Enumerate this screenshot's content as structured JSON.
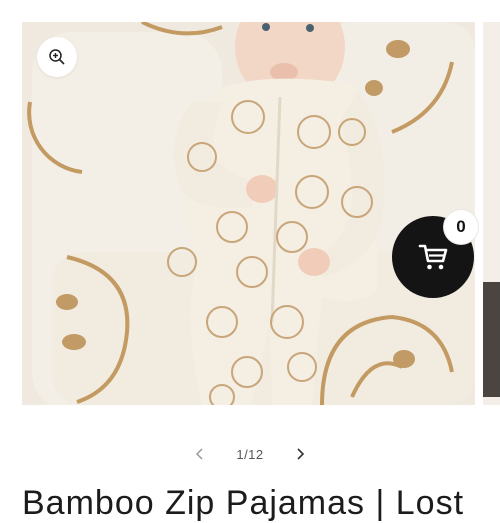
{
  "gallery": {
    "image_alt": "Baby in smiley face zip pajamas lying on smiley blanket",
    "zoom_icon": "zoom-in-icon"
  },
  "cart": {
    "icon": "cart-icon",
    "count": "0"
  },
  "pager": {
    "prev_icon": "chevron-left-icon",
    "next_icon": "chevron-right-icon",
    "current": 1,
    "total": 12,
    "label": "1/12"
  },
  "product": {
    "title": "Bamboo Zip Pajamas | Lost"
  },
  "colors": {
    "cart_bg": "#141414",
    "smiley": "#b9915a",
    "fabric": "#f2ecdf"
  }
}
